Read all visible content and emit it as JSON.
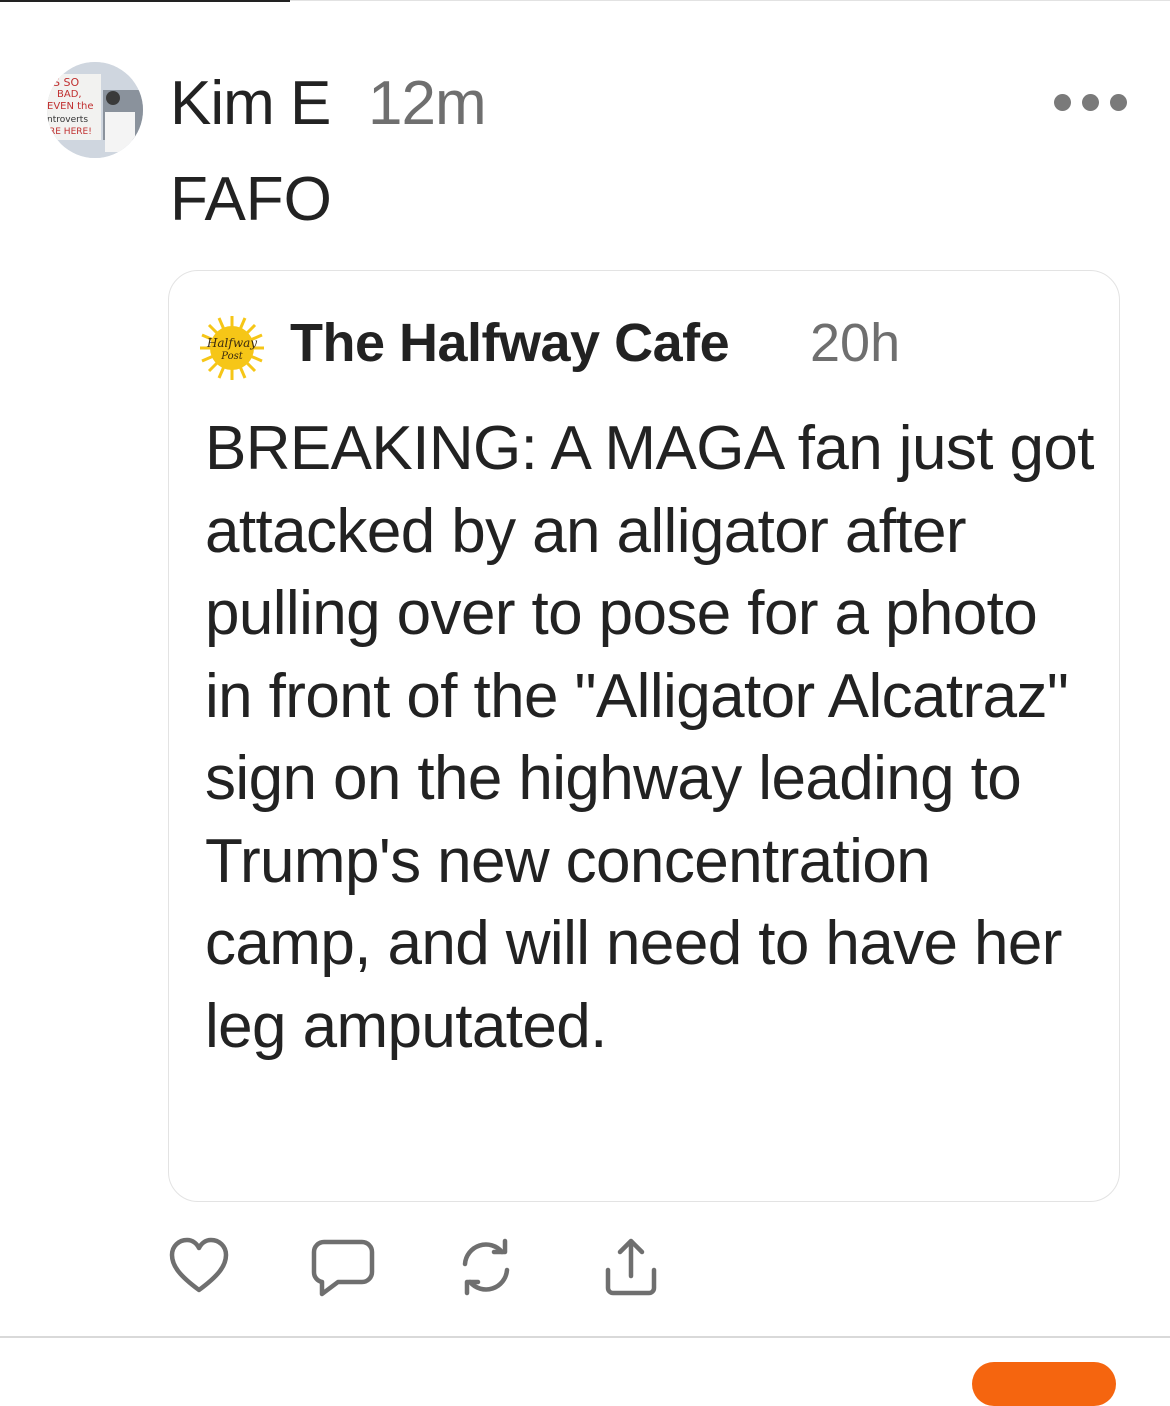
{
  "post": {
    "author": "Kim E",
    "time": "12m",
    "text": "FAFO",
    "avatar_sign_text": [
      "S SO",
      "BAD,",
      "EVEN the",
      "ntroverts",
      "RE HERE!"
    ],
    "more_icon": "more-horizontal-icon"
  },
  "quoted_post": {
    "author": "The Halfway Cafe",
    "time": "20h",
    "avatar_logo_text": [
      "Halfway",
      "Post"
    ],
    "text": "BREAKING: A MAGA fan just got attacked by an alligator after pulling over to pose for a photo in front of the \"Alligator Alcatraz\" sign on the highway leading to Trump's new concentration camp, and will need to have her leg amputated."
  },
  "actions": [
    {
      "icon": "heart-icon"
    },
    {
      "icon": "comment-icon"
    },
    {
      "icon": "repost-icon"
    },
    {
      "icon": "share-icon"
    }
  ],
  "colors": {
    "accent": "#f5650f",
    "text": "#222222",
    "muted": "#6f6f6f",
    "border": "#e3e3e3",
    "logo_yellow": "#f6c617"
  }
}
